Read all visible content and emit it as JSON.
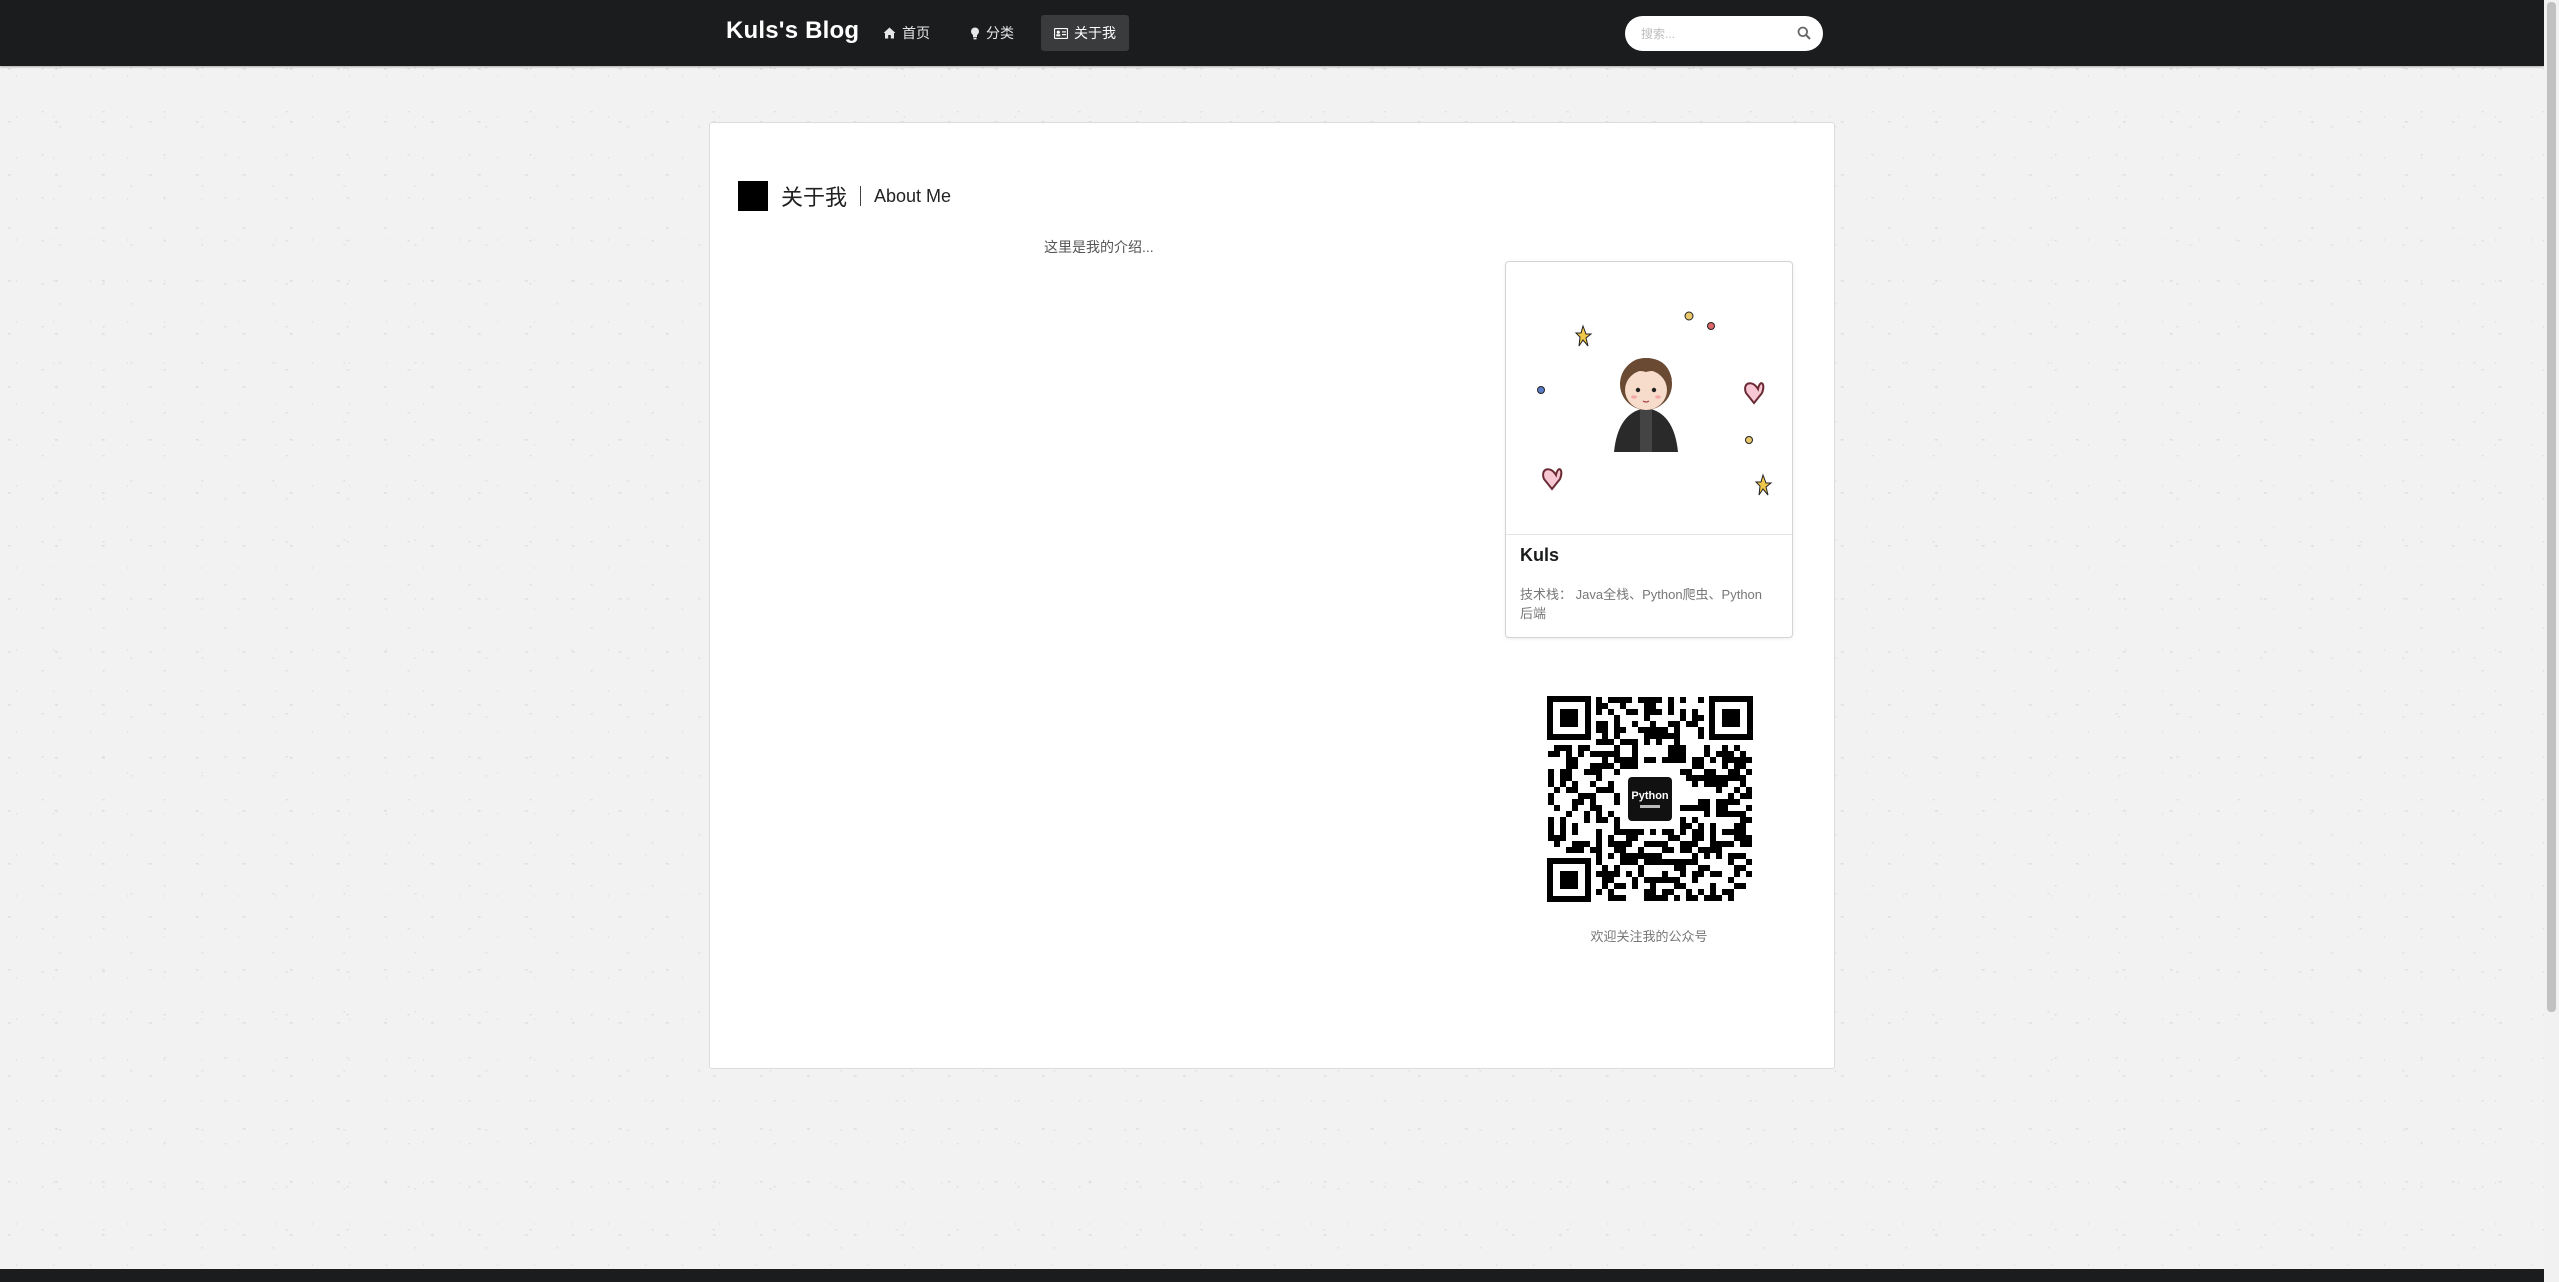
{
  "nav": {
    "brand": "Kuls's Blog",
    "items": [
      {
        "label": "首页",
        "icon": "home-icon",
        "active": false
      },
      {
        "label": "分类",
        "icon": "lightbulb-icon",
        "active": false
      },
      {
        "label": "关于我",
        "icon": "id-card-icon",
        "active": true
      }
    ],
    "search": {
      "placeholder": "搜索...",
      "value": ""
    }
  },
  "main": {
    "title": "关于我",
    "subtitle": "About Me",
    "intro": "这里是我的介绍..."
  },
  "profile": {
    "name": "Kuls",
    "description": "技术栈： Java全栈、Python爬虫、Python后端"
  },
  "qr": {
    "center_label": "Python",
    "caption": "欢迎关注我的公众号"
  },
  "colors": {
    "navbar": "#1b1c1d",
    "page_background": "#f2f2f2",
    "active_nav": "#3a3b3c"
  }
}
